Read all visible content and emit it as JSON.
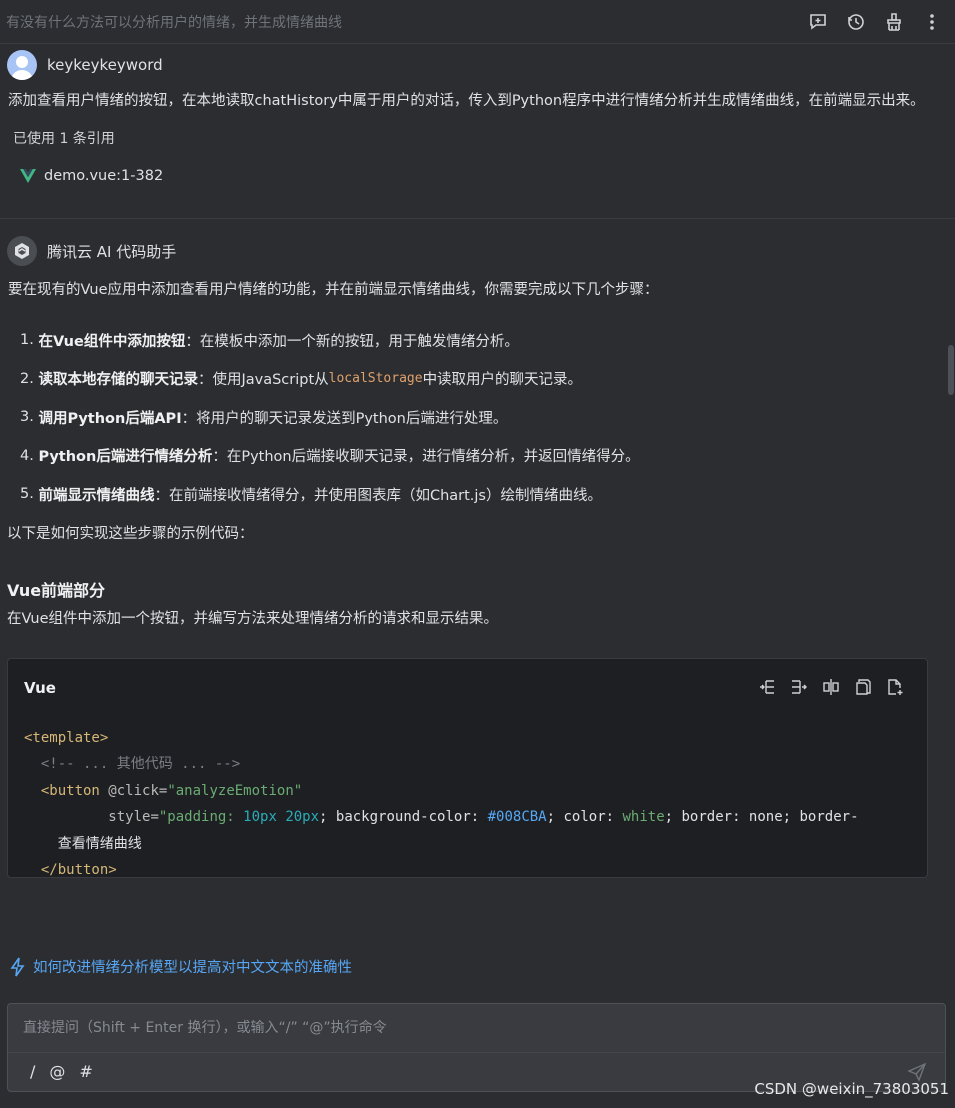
{
  "header": {
    "title": "有没有什么方法可以分析用户的情绪，并生成情绪曲线",
    "icons": [
      "new-chat-icon",
      "history-icon",
      "clear-icon",
      "more-icon"
    ]
  },
  "user_message": {
    "name": "keykeykeyword",
    "text": "添加查看用户情绪的按钮，在本地读取chatHistory中属于用户的对话，传入到Python程序中进行情绪分析并生成情绪曲线，在前端显示出来。",
    "ref_label": "已使用 1 条引用",
    "ref_item": "demo.vue:1-382"
  },
  "bot_message": {
    "name": "腾讯云 AI 代码助手",
    "intro": "要在现有的Vue应用中添加查看用户情绪的功能，并在前端显示情绪曲线，你需要完成以下几个步骤：",
    "steps": [
      {
        "num": "1.",
        "bold": "在Vue组件中添加按钮",
        "text": "：在模板中添加一个新的按钮，用于触发情绪分析。"
      },
      {
        "num": "2.",
        "bold": "读取本地存储的聊天记录",
        "text_a": "：使用JavaScript从",
        "code": "localStorage",
        "text_b": "中读取用户的聊天记录。"
      },
      {
        "num": "3.",
        "bold": "调用Python后端API",
        "text": "：将用户的聊天记录发送到Python后端进行处理。"
      },
      {
        "num": "4.",
        "bold": "Python后端进行情绪分析",
        "text": "：在Python后端接收聊天记录，进行情绪分析，并返回情绪得分。"
      },
      {
        "num": "5.",
        "bold": "前端显示情绪曲线",
        "text": "：在前端接收情绪得分，并使用图表库（如Chart.js）绘制情绪曲线。"
      }
    ],
    "after_steps": "以下是如何实现这些步骤的示例代码：",
    "section_title": "Vue前端部分",
    "section_desc": "在Vue组件中添加一个按钮，并编写方法来处理情绪分析的请求和显示结果。",
    "code": {
      "lang": "Vue",
      "line1": "<template>",
      "line2": "<!-- ... 其他代码 ... -->",
      "line3_tag": "<button",
      "line3_attr": " @click=",
      "line3_val": "\"analyzeEmotion\"",
      "line4_attr": "style=",
      "line4_a": "\"padding: ",
      "line4_n1": "10px 20px",
      "line4_b": "; background-color: ",
      "line4_hex": "#008CBA",
      "line4_c": "; color: ",
      "line4_w": "white",
      "line4_d": "; border: none; border-",
      "line5": "查看情绪曲线",
      "line6": "</button>"
    }
  },
  "suggestion": "如何改进情绪分析模型以提高对中文文本的准确性",
  "input": {
    "placeholder": "直接提问（Shift + Enter 换行），或输入“/” “@”执行命令",
    "cmd_slash": "/",
    "cmd_at": "@",
    "cmd_hash": "#"
  },
  "watermark": "CSDN @weixin_73803051",
  "colors": {
    "background": "#2b2d30",
    "code_bg": "#1e1f22",
    "link": "#57a6f5",
    "vue_green": "#41b883"
  }
}
